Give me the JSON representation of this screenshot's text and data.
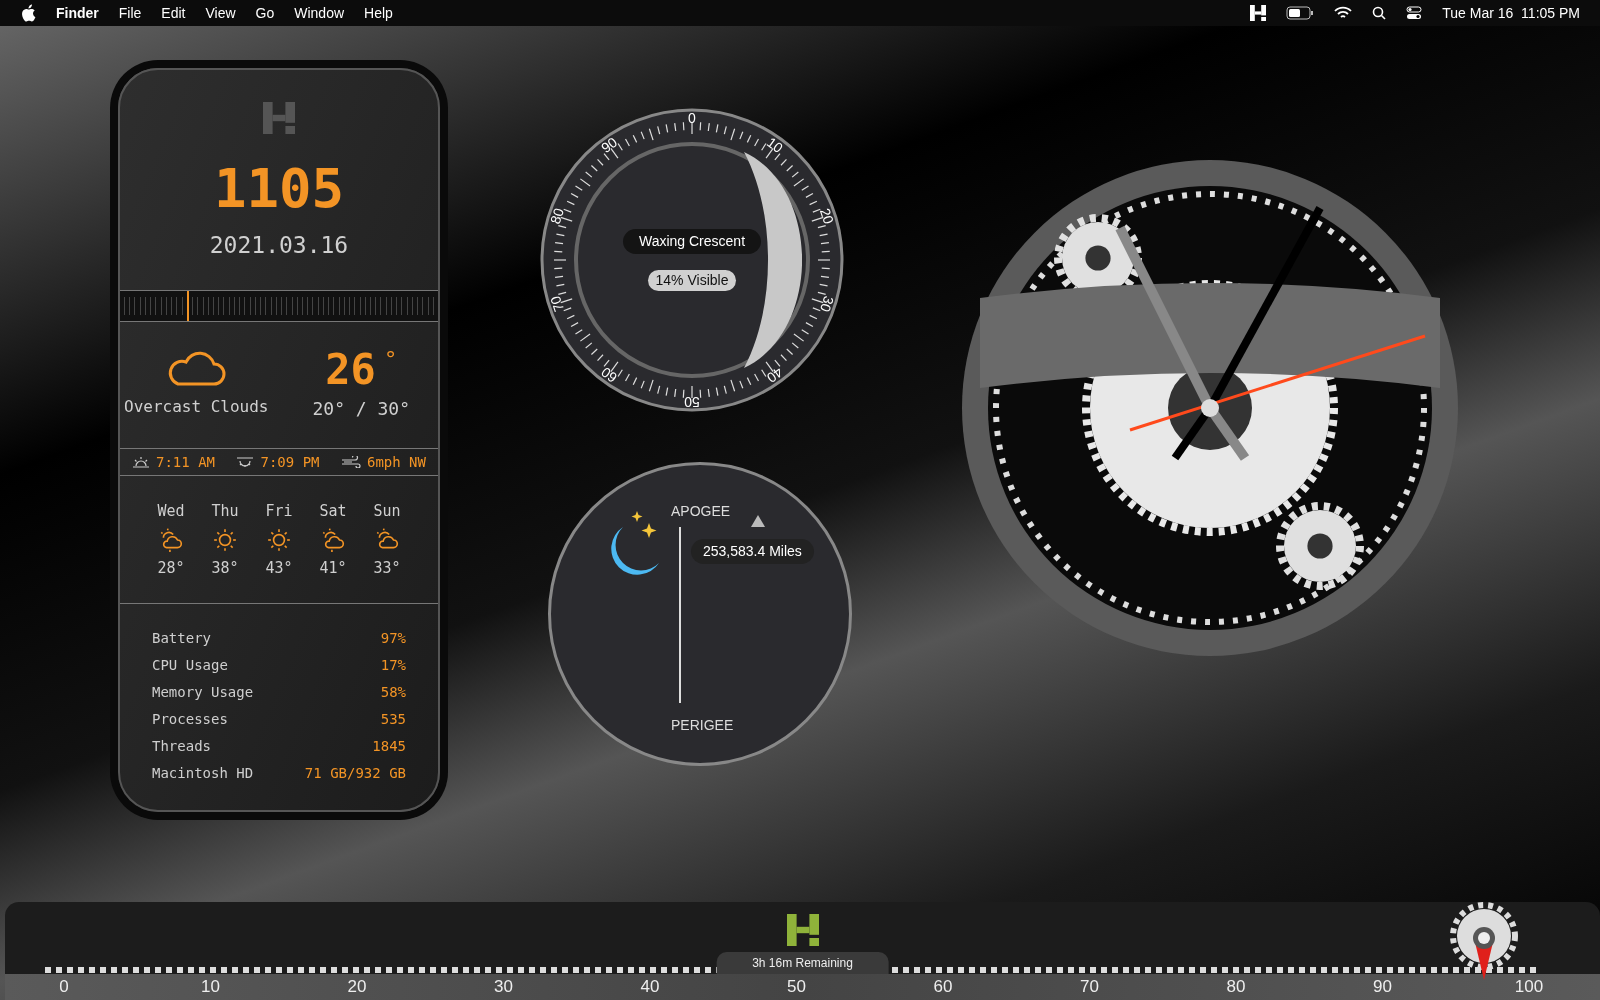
{
  "menu_bar": {
    "app": "Finder",
    "menus": [
      "File",
      "Edit",
      "View",
      "Go",
      "Window",
      "Help"
    ],
    "clock": "Tue Mar 16  11:05 PM"
  },
  "info_widget": {
    "time": "1105",
    "date": "2021.03.16",
    "day_progress": {
      "level": 0.21
    },
    "weather": {
      "condition": "Overcast Clouds",
      "temperature": "26",
      "degree": "°",
      "range": "20° / 30°"
    },
    "sun": {
      "sunrise": "7:11 AM",
      "sunset": "7:09 PM",
      "wind": "6mph NW"
    },
    "forecast": [
      {
        "day": "Wed",
        "kind": "cloud-sun-rain",
        "temp": "28°"
      },
      {
        "day": "Thu",
        "kind": "sun",
        "temp": "38°"
      },
      {
        "day": "Fri",
        "kind": "sun",
        "temp": "43°"
      },
      {
        "day": "Sat",
        "kind": "cloud-sun-rain",
        "temp": "41°"
      },
      {
        "day": "Sun",
        "kind": "cloud-sun",
        "temp": "33°"
      }
    ],
    "stats": [
      {
        "label": "Battery",
        "value": "97%"
      },
      {
        "label": "CPU Usage",
        "value": "17%"
      },
      {
        "label": "Memory Usage",
        "value": "58%"
      },
      {
        "label": "Processes",
        "value": "535"
      },
      {
        "label": "Threads",
        "value": "1845"
      },
      {
        "label": "Macintosh HD",
        "value": "71 GB/932 GB"
      }
    ]
  },
  "moon_phase": {
    "dial_labels": [
      "0",
      "10",
      "20",
      "30",
      "40",
      "50",
      "60",
      "70",
      "80",
      "90"
    ],
    "phase": "Waxing Crescent",
    "visible": "14% Visible"
  },
  "moon_distance": {
    "apogee": "APOGEE",
    "perigee": "PERIGEE",
    "distance": "253,583.4 Miles"
  },
  "battery_bar": {
    "remaining": "3h 16m Remaining",
    "scale": [
      "0",
      "10",
      "20",
      "30",
      "40",
      "50",
      "60",
      "70",
      "80",
      "90",
      "100"
    ],
    "level": 0.97
  }
}
